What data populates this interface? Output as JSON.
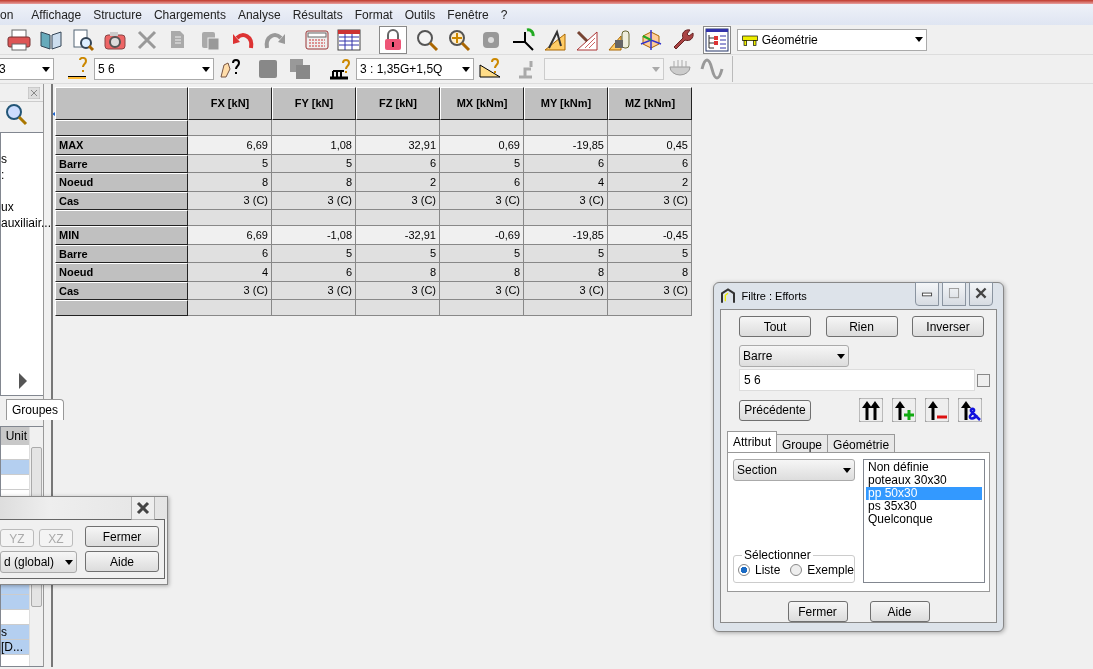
{
  "menu": [
    "on",
    "Affichage",
    "Structure",
    "Chargements",
    "Analyse",
    "Résultats",
    "Format",
    "Outils",
    "Fenêtre",
    "?"
  ],
  "toolbar": {
    "view_combo": "Géométrie",
    "selection_combo": "3",
    "bars_combo": "5 6",
    "load_case_combo": "3 : 1,35G+1,5Q"
  },
  "left_panel": {
    "list_items": [
      "s",
      ":",
      "ux",
      "auxiliair..."
    ],
    "tab": "Groupes",
    "grid_header": "Unit",
    "grid_rows_top": [
      {
        "selected": false
      },
      {
        "selected": true
      },
      {
        "selected": false
      }
    ],
    "grid_rows_bottom": [
      {
        "selected": true
      },
      {
        "selected": true
      },
      {
        "selected": false
      },
      {
        "text": "s",
        "selected": true
      },
      {
        "text": "[D...",
        "selected": true
      }
    ]
  },
  "table": {
    "columns": [
      "FX [kN]",
      "FY [kN]",
      "FZ [kN]",
      "MX [kNm]",
      "MY [kNm]",
      "MZ [kNm]"
    ],
    "rows": [
      {
        "kind": "blank"
      },
      {
        "kind": "extreme",
        "label": "MAX",
        "cells": [
          "6,69",
          "1,08",
          "32,91",
          "0,69",
          "-19,85",
          "0,45"
        ]
      },
      {
        "kind": "data",
        "label": "Barre",
        "cells": [
          "5",
          "5",
          "6",
          "5",
          "6",
          "6"
        ]
      },
      {
        "kind": "data",
        "label": "Noeud",
        "cells": [
          "8",
          "8",
          "2",
          "6",
          "4",
          "2"
        ]
      },
      {
        "kind": "data",
        "label": "Cas",
        "cells": [
          "3 (C)",
          "3 (C)",
          "3 (C)",
          "3 (C)",
          "3 (C)",
          "3 (C)"
        ]
      },
      {
        "kind": "blank"
      },
      {
        "kind": "extreme",
        "label": "MIN",
        "cells": [
          "6,69",
          "-1,08",
          "-32,91",
          "-0,69",
          "-19,85",
          "-0,45"
        ]
      },
      {
        "kind": "data",
        "label": "Barre",
        "cells": [
          "6",
          "5",
          "5",
          "5",
          "5",
          "5"
        ]
      },
      {
        "kind": "data",
        "label": "Noeud",
        "cells": [
          "4",
          "6",
          "8",
          "8",
          "8",
          "8"
        ]
      },
      {
        "kind": "data",
        "label": "Cas",
        "cells": [
          "3 (C)",
          "3 (C)",
          "3 (C)",
          "3 (C)",
          "3 (C)",
          "3 (C)"
        ]
      },
      {
        "kind": "blank"
      }
    ]
  },
  "view_dialog": {
    "axis_buttons": [
      {
        "label": "YZ",
        "disabled": true
      },
      {
        "label": "XZ",
        "disabled": true
      }
    ],
    "system_combo": "d (global)",
    "buttons": [
      "Fermer",
      "Aide"
    ]
  },
  "filter_dialog": {
    "title": "Filtre : Efforts",
    "top_buttons": [
      "Tout",
      "Rien",
      "Inverser"
    ],
    "type_combo": "Barre",
    "selection_field": "5 6",
    "auto_checkbox": {
      "checked": false
    },
    "previous_button": "Précédente",
    "tabs": [
      {
        "label": "Attribut",
        "selected": true
      },
      {
        "label": "Groupe",
        "selected": false
      },
      {
        "label": "Géométrie",
        "selected": false
      }
    ],
    "attribute_combo": "Section",
    "values": [
      {
        "label": "Non définie",
        "selected": false
      },
      {
        "label": "poteaux 30x30",
        "selected": false
      },
      {
        "label": "pp 50x30",
        "selected": true
      },
      {
        "label": "ps 35x30",
        "selected": false
      },
      {
        "label": "Quelconque",
        "selected": false
      }
    ],
    "select_group": {
      "title": "Sélectionner",
      "options": [
        {
          "label": "Liste",
          "selected": true
        },
        {
          "label": "Exemple",
          "selected": false
        }
      ]
    },
    "buttons": [
      "Fermer",
      "Aide"
    ]
  }
}
